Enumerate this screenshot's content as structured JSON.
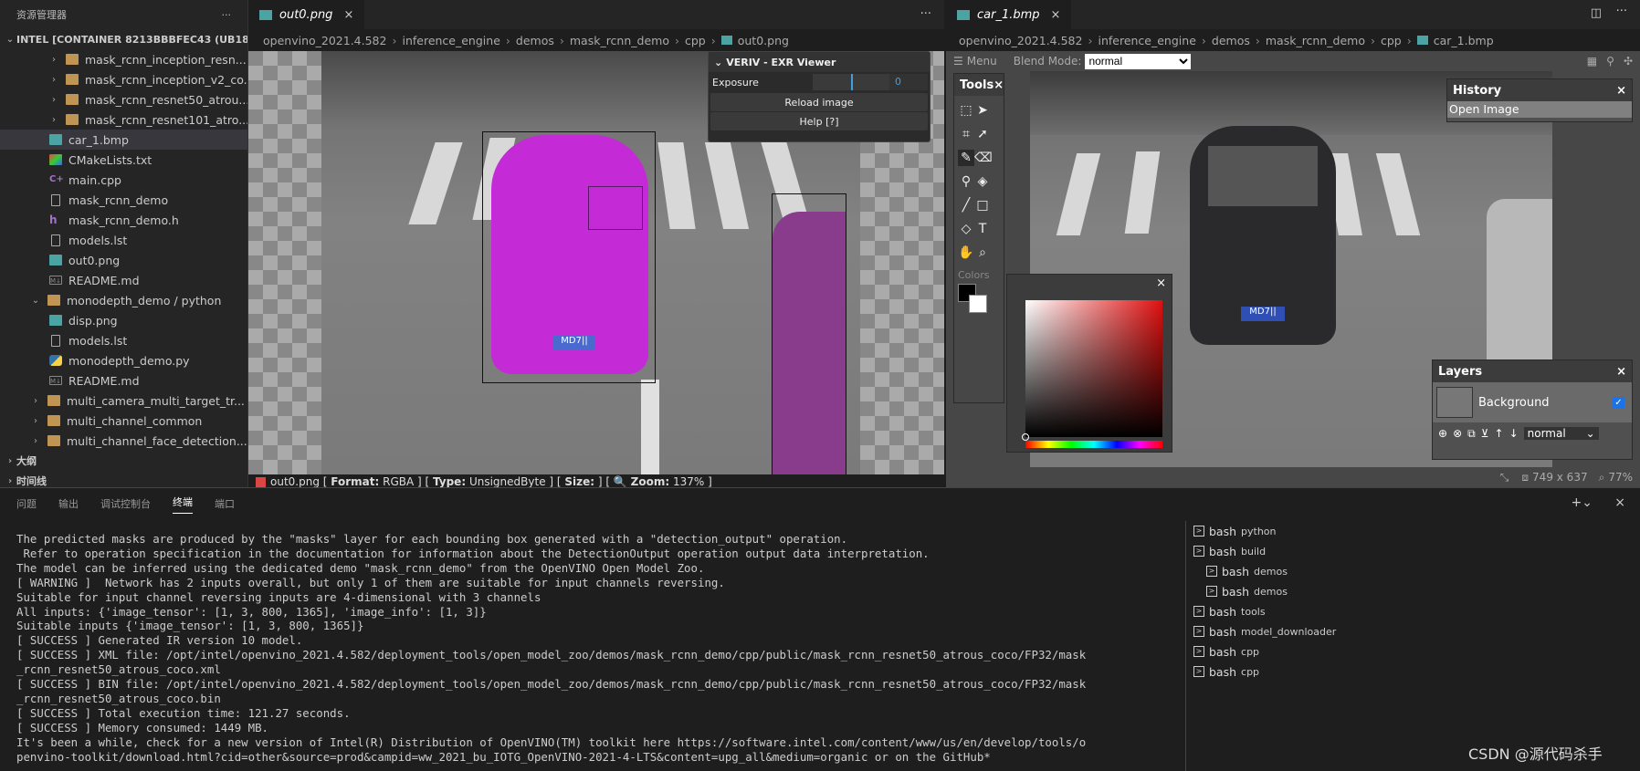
{
  "sidebar": {
    "title": "资源管理器",
    "more": "···",
    "root": "INTEL [CONTAINER 8213BBBFEC43 (UB18_CV...",
    "items": [
      {
        "name": "mask_rcnn_inception_resn...",
        "type": "folder",
        "depth": 1
      },
      {
        "name": "mask_rcnn_inception_v2_co...",
        "type": "folder",
        "depth": 1
      },
      {
        "name": "mask_rcnn_resnet50_atrou...",
        "type": "folder",
        "depth": 1
      },
      {
        "name": "mask_rcnn_resnet101_atro...",
        "type": "folder",
        "depth": 1
      },
      {
        "name": "car_1.bmp",
        "type": "img",
        "depth": 0
      },
      {
        "name": "CMakeLists.txt",
        "type": "cmake",
        "depth": 0
      },
      {
        "name": "main.cpp",
        "type": "cpp",
        "depth": 0
      },
      {
        "name": "mask_rcnn_demo",
        "type": "file",
        "depth": 0
      },
      {
        "name": "mask_rcnn_demo.h",
        "type": "h",
        "depth": 0
      },
      {
        "name": "models.lst",
        "type": "file",
        "depth": 0
      },
      {
        "name": "out0.png",
        "type": "img",
        "depth": 0
      },
      {
        "name": "README.md",
        "type": "md",
        "depth": 0
      },
      {
        "name": "monodepth_demo / python",
        "type": "folder-open",
        "depth": -1
      },
      {
        "name": "disp.png",
        "type": "img",
        "depth": 0
      },
      {
        "name": "models.lst",
        "type": "file",
        "depth": 0
      },
      {
        "name": "monodepth_demo.py",
        "type": "py",
        "depth": 0
      },
      {
        "name": "README.md",
        "type": "md",
        "depth": 0
      },
      {
        "name": "multi_camera_multi_target_tr...",
        "type": "folder",
        "depth": -1
      },
      {
        "name": "multi_channel_common",
        "type": "folder",
        "depth": -1
      },
      {
        "name": "multi_channel_face_detection...",
        "type": "folder",
        "depth": -1
      }
    ],
    "outline": "大纲",
    "timeline": "时间线"
  },
  "editor1": {
    "tab": "out0.png",
    "breadcrumb": [
      "openvino_2021.4.582",
      "inference_engine",
      "demos",
      "mask_rcnn_demo",
      "cpp",
      "out0.png"
    ],
    "more": "···",
    "exr": {
      "title": "VERIV - EXR Viewer",
      "exposure_label": "Exposure",
      "exposure_value": "0",
      "reload": "Reload image",
      "help": "Help [?]"
    },
    "status": {
      "file": "out0.png",
      "format_label": "Format:",
      "format": "RGBA",
      "type_label": "Type:",
      "type": "UnsignedByte",
      "size_label": "Size:",
      "zoom_label": "Zoom:",
      "zoom": "137%"
    },
    "plate": "MD7||"
  },
  "editor2": {
    "tab": "car_1.bmp",
    "breadcrumb": [
      "openvino_2021.4.582",
      "inference_engine",
      "demos",
      "mask_rcnn_demo",
      "cpp",
      "car_1.bmp"
    ],
    "menu": "Menu",
    "blend_label": "Blend Mode:",
    "blend_value": "normal",
    "tools_title": "Tools",
    "colors_label": "Colors",
    "history_title": "History",
    "history_item": "Open Image",
    "layers_title": "Layers",
    "layer_name": "Background",
    "layer_blend": "normal",
    "dims": "749 x 637",
    "zoom": "77%",
    "plate": "MD7||"
  },
  "panel": {
    "tabs": [
      "问题",
      "输出",
      "调试控制台",
      "终端",
      "端口"
    ],
    "active_tab": "终端",
    "terminal_lines": [
      "The predicted masks are produced by the \"masks\" layer for each bounding box generated with a \"detection_output\" operation.",
      " Refer to operation specification in the documentation for information about the DetectionOutput operation output data interpretation.",
      "The model can be inferred using the dedicated demo \"mask_rcnn_demo\" from the OpenVINO Open Model Zoo.",
      "[ WARNING ]  Network has 2 inputs overall, but only 1 of them are suitable for input channels reversing.",
      "Suitable for input channel reversing inputs are 4-dimensional with 3 channels",
      "All inputs: {'image_tensor': [1, 3, 800, 1365], 'image_info': [1, 3]}",
      "Suitable inputs {'image_tensor': [1, 3, 800, 1365]}",
      "[ SUCCESS ] Generated IR version 10 model.",
      "[ SUCCESS ] XML file: /opt/intel/openvino_2021.4.582/deployment_tools/open_model_zoo/demos/mask_rcnn_demo/cpp/public/mask_rcnn_resnet50_atrous_coco/FP32/mask",
      "_rcnn_resnet50_atrous_coco.xml",
      "[ SUCCESS ] BIN file: /opt/intel/openvino_2021.4.582/deployment_tools/open_model_zoo/demos/mask_rcnn_demo/cpp/public/mask_rcnn_resnet50_atrous_coco/FP32/mask",
      "_rcnn_resnet50_atrous_coco.bin",
      "[ SUCCESS ] Total execution time: 121.27 seconds.",
      "[ SUCCESS ] Memory consumed: 1449 MB.",
      "It's been a while, check for a new version of Intel(R) Distribution of OpenVINO(TM) toolkit here https://software.intel.com/content/www/us/en/develop/tools/o",
      "penvino-toolkit/download.html?cid=other&source=prod&campid=ww_2021_bu_IOTG_OpenVINO-2021-4-LTS&content=upg_all&medium=organic or on the GitHub*"
    ],
    "terminals": [
      {
        "shell": "bash",
        "name": "python"
      },
      {
        "shell": "bash",
        "name": "build"
      },
      {
        "shell": "bash",
        "name": "demos"
      },
      {
        "shell": "bash",
        "name": "demos"
      },
      {
        "shell": "bash",
        "name": "tools"
      },
      {
        "shell": "bash",
        "name": "model_downloader"
      },
      {
        "shell": "bash",
        "name": "cpp"
      },
      {
        "shell": "bash",
        "name": "cpp"
      }
    ]
  },
  "watermark": "CSDN @源代码杀手",
  "colors": {
    "magenta_mask": "#c42ad6",
    "accent": "#007acc"
  }
}
